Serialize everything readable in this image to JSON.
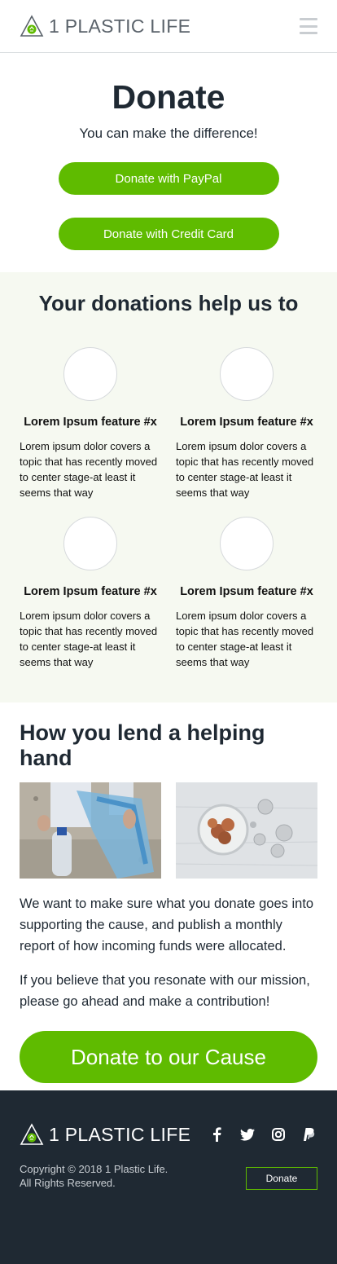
{
  "brand": {
    "name": "1 PLASTIC LIFE",
    "accent": "#5fbb00",
    "dark": "#1f2933"
  },
  "header": {
    "menu_icon": "hamburger-icon"
  },
  "hero": {
    "title": "Donate",
    "tagline": "You can make the difference!",
    "paypal_label": "Donate with PayPal",
    "card_label": "Donate with Credit Card"
  },
  "features": {
    "heading": "Your donations help us to",
    "items": [
      {
        "title": "Lorem Ipsum feature #x",
        "text": "Lorem ipsum dolor covers a topic that has recently moved to center stage-at least it seems that way"
      },
      {
        "title": "Lorem Ipsum feature #x",
        "text": "Lorem ipsum dolor covers a topic that has recently moved to center stage-at least it seems that way"
      },
      {
        "title": "Lorem Ipsum feature #x",
        "text": "Lorem ipsum dolor covers a topic that has recently moved to center stage-at least it seems that way"
      },
      {
        "title": "Lorem Ipsum feature #x",
        "text": "Lorem ipsum dolor covers a topic that has recently moved to center stage-at least it seems that way"
      }
    ]
  },
  "help": {
    "heading": "How you lend a helping hand",
    "paragraph1": "We want to make sure what you donate goes into supporting the cause, and publish a monthly report of how incoming funds were allocated.",
    "paragraph2": "If you believe that you resonate with our mission, please go ahead and make a contribution!",
    "cta_label": "Donate to our Cause"
  },
  "footer": {
    "copyright_line1": "Copyright © 2018 1 Plastic Life.",
    "copyright_line2": "All Rights Reserved.",
    "donate_label": "Donate",
    "socials": [
      "facebook-icon",
      "twitter-icon",
      "instagram-icon",
      "paypal-icon"
    ]
  }
}
